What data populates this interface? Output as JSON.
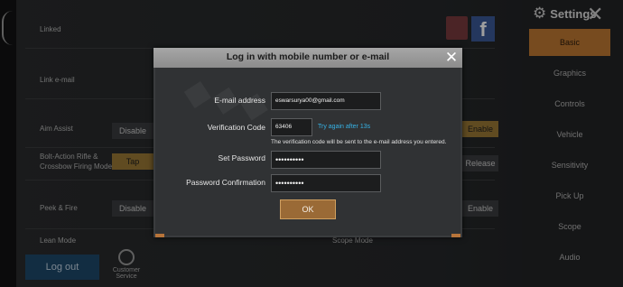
{
  "background": {
    "rows": [
      {
        "label": "Linked"
      },
      {
        "label": "Link e-mail"
      },
      {
        "label": "Aim Assist",
        "option": "Disable",
        "right_option": "Enable"
      },
      {
        "label": "Bolt-Action Rifle & Crossbow Firing Mode",
        "option": "Tap",
        "right_option": "Release"
      },
      {
        "label": "Peek & Fire",
        "option": "Disable",
        "right_option": "Enable"
      },
      {
        "label": "Lean Mode",
        "right_label": "Scope Mode"
      }
    ],
    "facebook_glyph": "f",
    "logout_label": "Log out",
    "service_label": "Customer Service"
  },
  "sidebar": {
    "title": "Settings",
    "gear_icon": "⚙",
    "close_glyph": "✕",
    "items": [
      {
        "label": "Basic",
        "active": true
      },
      {
        "label": "Graphics"
      },
      {
        "label": "Controls"
      },
      {
        "label": "Vehicle"
      },
      {
        "label": "Sensitivity"
      },
      {
        "label": "Pick Up"
      },
      {
        "label": "Scope"
      },
      {
        "label": "Audio"
      }
    ]
  },
  "dialog": {
    "title": "Log in with mobile number or e-mail",
    "close_glyph": "✕",
    "email_label": "E-mail address",
    "email_value": "eswarsurya00@gmail.com",
    "code_label": "Verification Code",
    "code_value": "63406",
    "retry_text": "Try again after 13s",
    "note": "The verification code will be sent to the e-mail address you entered.",
    "password_label": "Set Password",
    "password_value": "••••••••••",
    "confirm_label": "Password Confirmation",
    "confirm_value": "••••••••••",
    "ok_label": "OK"
  }
}
